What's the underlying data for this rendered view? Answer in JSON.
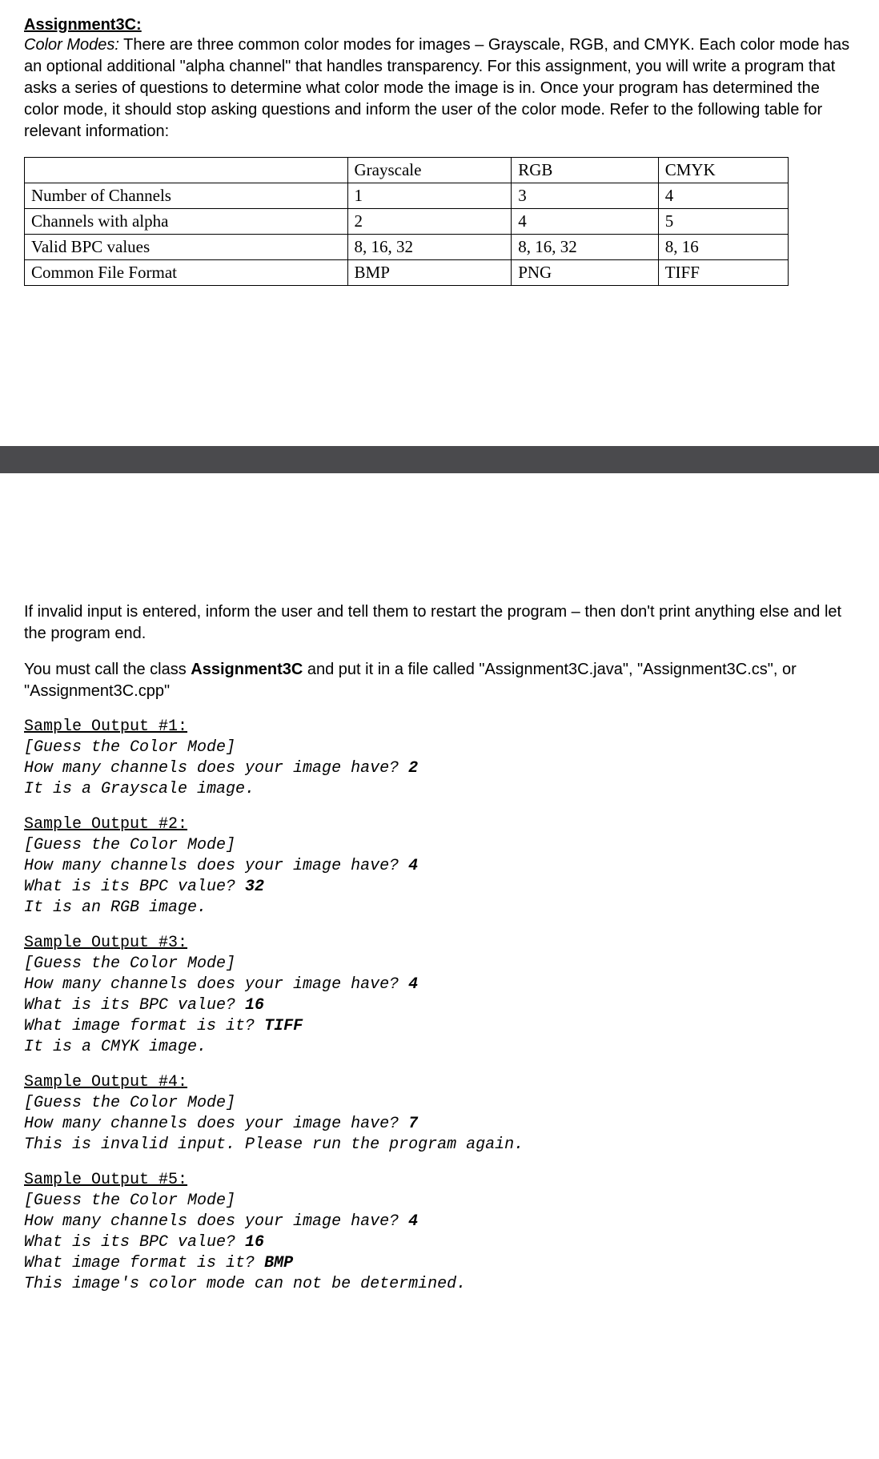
{
  "header": {
    "title": "Assignment3C:",
    "intro_prefix_italic": "Color Modes:",
    "intro_body": " There are three common color modes for images – Grayscale, RGB, and CMYK. Each color mode has an optional additional \"alpha channel\" that handles transparency. For this assignment, you will write a program that asks a series of questions to determine what color mode the image is in. Once your program has determined the color mode, it should stop asking questions and inform the user of the color mode. Refer to the following table for relevant information:"
  },
  "table": {
    "cols": [
      "",
      "Grayscale",
      "RGB",
      "CMYK"
    ],
    "rows": [
      {
        "label": "Number of Channels",
        "c1": "1",
        "c2": "3",
        "c3": "4"
      },
      {
        "label": "Channels with alpha",
        "c1": "2",
        "c2": "4",
        "c3": "5"
      },
      {
        "label": "Valid BPC values",
        "c1": "8, 16, 32",
        "c2": "8, 16, 32",
        "c3": "8, 16"
      },
      {
        "label": "Common File Format",
        "c1": "BMP",
        "c2": "PNG",
        "c3": "TIFF"
      }
    ]
  },
  "post": {
    "invalid_note": "If invalid input is entered, inform the user and tell them to restart the program – then don't print anything else and let the program end.",
    "class_note_pre": "You must call the class ",
    "class_name": "Assignment3C",
    "class_note_post": " and put it in a file called \"Assignment3C.java\", \"Assignment3C.cs\", or \"Assignment3C.cpp\""
  },
  "samples": [
    {
      "title": "Sample Output #1:",
      "lines": [
        {
          "text": "[Guess the Color Mode]"
        },
        {
          "text": "How many channels does your image have? ",
          "input": "2"
        },
        {
          "text": "It is a Grayscale image."
        }
      ]
    },
    {
      "title": "Sample Output #2:",
      "lines": [
        {
          "text": "[Guess the Color Mode]"
        },
        {
          "text": "How many channels does your image have? ",
          "input": "4"
        },
        {
          "text": "What is its BPC value? ",
          "input": "32"
        },
        {
          "text": "It is an RGB image."
        }
      ]
    },
    {
      "title": "Sample Output #3:",
      "lines": [
        {
          "text": "[Guess the Color Mode]"
        },
        {
          "text": "How many channels does your image have? ",
          "input": "4"
        },
        {
          "text": "What is its BPC value? ",
          "input": "16"
        },
        {
          "text": "What image format is it? ",
          "input": "TIFF"
        },
        {
          "text": "It is a CMYK image."
        }
      ]
    },
    {
      "title": "Sample Output #4:",
      "lines": [
        {
          "text": "[Guess the Color Mode]"
        },
        {
          "text": "How many channels does your image have? ",
          "input": "7"
        },
        {
          "text": "This is invalid input. Please run the program again."
        }
      ]
    },
    {
      "title": "Sample Output #5:",
      "lines": [
        {
          "text": "[Guess the Color Mode]"
        },
        {
          "text": "How many channels does your image have? ",
          "input": "4"
        },
        {
          "text": "What is its BPC value? ",
          "input": "16"
        },
        {
          "text": "What image format is it? ",
          "input": "BMP"
        },
        {
          "text": "This image's color mode can not be determined."
        }
      ]
    }
  ]
}
